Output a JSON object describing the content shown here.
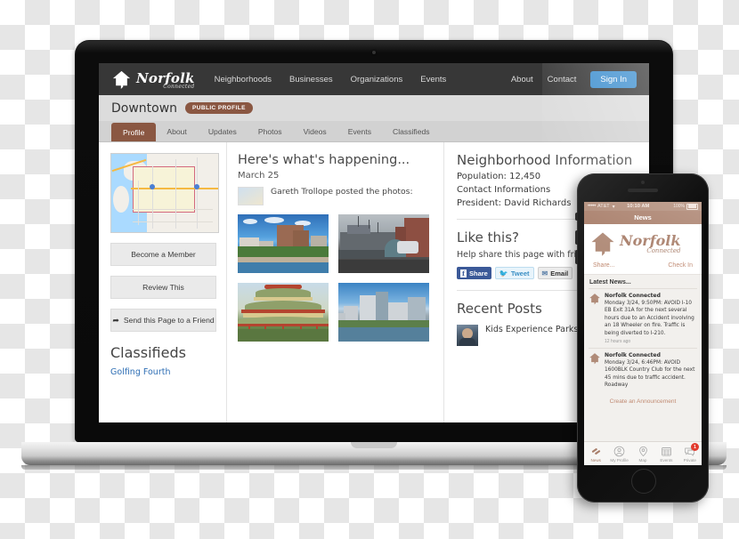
{
  "site": {
    "brand": {
      "title": "Norfolk",
      "subtitle": "Connected",
      "icon": "house-icon"
    },
    "nav": [
      {
        "label": "Neighborhoods"
      },
      {
        "label": "Businesses"
      },
      {
        "label": "Organizations"
      },
      {
        "label": "Events"
      }
    ],
    "nav_right": [
      {
        "label": "About"
      },
      {
        "label": "Contact"
      }
    ],
    "signin_label": "Sign In"
  },
  "profile": {
    "name": "Downtown",
    "badge": "PUBLIC PROFILE",
    "tabs": [
      {
        "label": "Profile",
        "active": true
      },
      {
        "label": "About",
        "active": false
      },
      {
        "label": "Updates",
        "active": false
      },
      {
        "label": "Photos",
        "active": false
      },
      {
        "label": "Videos",
        "active": false
      },
      {
        "label": "Events",
        "active": false
      },
      {
        "label": "Classifieds",
        "active": false
      }
    ]
  },
  "left": {
    "map_alt": "neighborhood-boundary-map",
    "buttons": [
      {
        "label": "Become a Member",
        "icon": ""
      },
      {
        "label": "Review This",
        "icon": ""
      },
      {
        "label": "Send this Page to a Friend",
        "icon": "share-arrow-icon"
      }
    ],
    "classifieds_heading": "Classifieds",
    "classifieds_links": [
      {
        "label": "Golfing Fourth"
      }
    ]
  },
  "middle": {
    "heading": "Here's what's happening...",
    "date": "March 25",
    "post_text": "Gareth Trollope posted the photos:",
    "photos": [
      {
        "name": "waterfront-condos-photo"
      },
      {
        "name": "battleship-wisconsin-photo"
      },
      {
        "name": "pagoda-garden-photo"
      },
      {
        "name": "downtown-skyline-photo"
      }
    ]
  },
  "right": {
    "info_heading": "Neighborhood Information",
    "info_lines": [
      "Population: 12,450",
      "Contact Informations",
      "President: David Richards"
    ],
    "like_heading": "Like this?",
    "like_sub": "Help share this page with friends",
    "share_buttons": [
      {
        "label": "Share",
        "glyph": "f",
        "name": "facebook-share-button"
      },
      {
        "label": "Tweet",
        "glyph": "✈",
        "name": "twitter-tweet-button"
      },
      {
        "label": "Email",
        "glyph": "✉",
        "name": "email-share-button"
      }
    ],
    "recent_heading": "Recent Posts",
    "recent_posts": [
      {
        "text": "Kids Experience Parks",
        "avatar": "user-avatar"
      }
    ]
  },
  "phone": {
    "status": {
      "signal_dots": "•••••",
      "carrier": "AT&T",
      "wifi": "▾",
      "time": "10:10 AM",
      "battery_pct": "100%"
    },
    "navbar_title": "News",
    "logo": {
      "title": "Norfolk",
      "subtitle": "Connected",
      "icon": "house-icon"
    },
    "actions": [
      {
        "label": "Share..."
      },
      {
        "label": "Check In"
      }
    ],
    "latest_label": "Latest News...",
    "news": [
      {
        "source": "Norfolk Connected",
        "text": "Monday 3/24, 9:50PM: AVOID I-10 EB Exit 31A for the next several hours due to an Accident involving an 18 Wheeler on fire. Traffic is being diverted to I-210.",
        "time": "12 hours ago"
      },
      {
        "source": "Norfolk Connected",
        "text": "Monday 3/24, 6:46PM: AVOID 1600BLK Country Club for the next 45 mins due to traffic accident. Roadway",
        "time": ""
      }
    ],
    "announce_label": "Create an Announcement",
    "tabs": [
      {
        "label": "News",
        "icon": "news-icon",
        "active": true,
        "badge": ""
      },
      {
        "label": "My Profile",
        "icon": "person-icon",
        "active": false,
        "badge": ""
      },
      {
        "label": "Map",
        "icon": "map-pin-icon",
        "active": false,
        "badge": ""
      },
      {
        "label": "Events",
        "icon": "calendar-icon",
        "active": false,
        "badge": ""
      },
      {
        "label": "Private",
        "icon": "chat-icon",
        "active": false,
        "badge": "1"
      }
    ]
  },
  "colors": {
    "brand_brown": "#8a5742",
    "phone_brown": "#a97f6b",
    "accent_blue": "#3e8fcf",
    "link_blue": "#2f6fb5",
    "badge_red": "#e23b2e"
  }
}
